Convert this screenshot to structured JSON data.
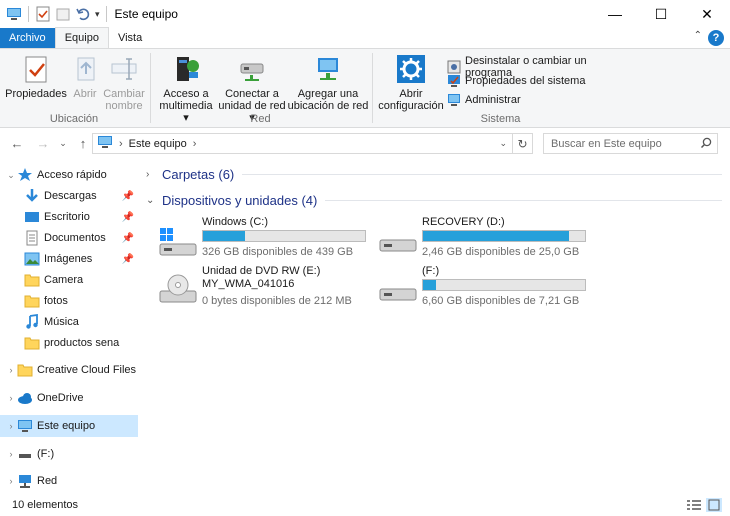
{
  "window": {
    "title": "Este equipo",
    "minimize": "—",
    "maximize": "☐",
    "close": "✕"
  },
  "tabs": [
    {
      "label": "Archivo"
    },
    {
      "label": "Equipo"
    },
    {
      "label": "Vista"
    }
  ],
  "ribbon": {
    "ubicacion": {
      "label": "Ubicación",
      "propiedades": "Propiedades",
      "abrir": "Abrir",
      "cambiar_nombre_1": "Cambiar",
      "cambiar_nombre_2": "nombre"
    },
    "red": {
      "label": "Red",
      "acceso_1": "Acceso a",
      "acceso_2": "multimedia",
      "conectar_1": "Conectar a",
      "conectar_2": "unidad de red",
      "agregar_1": "Agregar una",
      "agregar_2": "ubicación de red"
    },
    "sistema": {
      "label": "Sistema",
      "abrir_config_1": "Abrir",
      "abrir_config_2": "configuración",
      "desinstalar": "Desinstalar o cambiar un programa",
      "propiedades_sistema": "Propiedades del sistema",
      "administrar": "Administrar"
    }
  },
  "address": {
    "path": "Este equipo",
    "search_placeholder": "Buscar en Este equipo"
  },
  "nav": {
    "items": [
      {
        "label": "Acceso rápido"
      },
      {
        "label": "Descargas"
      },
      {
        "label": "Escritorio"
      },
      {
        "label": "Documentos"
      },
      {
        "label": "Imágenes"
      },
      {
        "label": "Camera"
      },
      {
        "label": "fotos"
      },
      {
        "label": "Música"
      },
      {
        "label": "productos sena"
      },
      {
        "label": "Creative Cloud Files"
      },
      {
        "label": "OneDrive"
      },
      {
        "label": "Este equipo"
      },
      {
        "label": "(F:)"
      },
      {
        "label": "Red"
      }
    ]
  },
  "content": {
    "folders_header": "Carpetas (6)",
    "devices_header": "Dispositivos y unidades (4)",
    "drives": [
      {
        "name": "Windows (C:)",
        "free": "326 GB disponibles de 439 GB",
        "used_fraction": 0.26
      },
      {
        "name": "RECOVERY (D:)",
        "free": "2,46 GB disponibles de 25,0 GB",
        "used_fraction": 0.9
      },
      {
        "name": "Unidad de DVD RW (E:)",
        "name2": "MY_WMA_041016",
        "free": "0 bytes disponibles de 212 MB"
      },
      {
        "name": "(F:)",
        "free": "6,60 GB disponibles de 7,21 GB",
        "used_fraction": 0.08
      }
    ]
  },
  "status": {
    "count": "10 elementos"
  },
  "colors": {
    "accent": "#1979ca",
    "bar_fill": "#26a0da",
    "header_text": "#1e3287",
    "selection": "#cce8ff"
  }
}
